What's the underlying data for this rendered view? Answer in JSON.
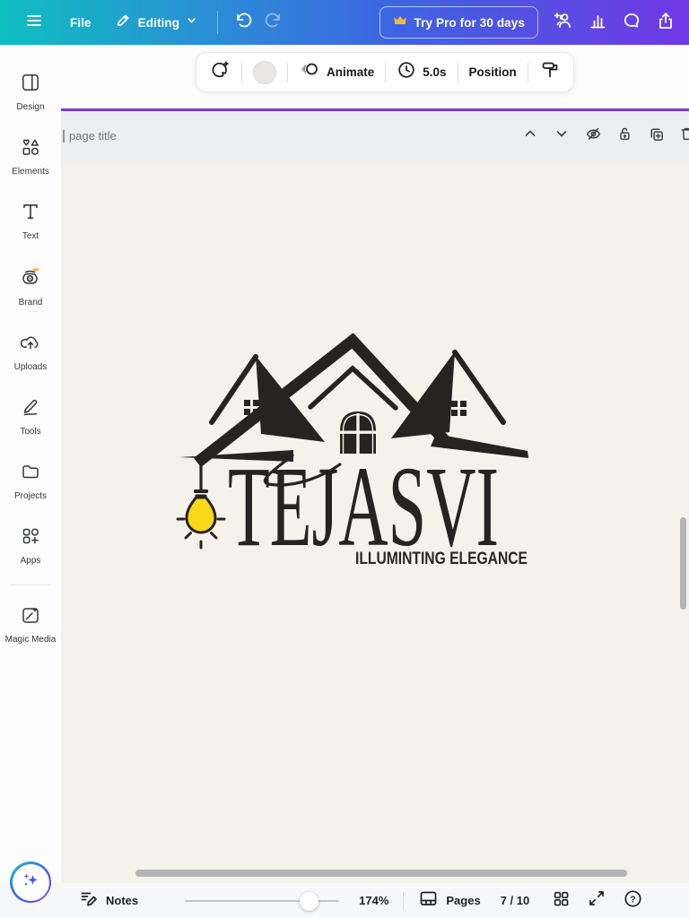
{
  "topbar": {
    "file_label": "File",
    "editing_label": "Editing",
    "try_pro_label": "Try Pro for 30 days"
  },
  "sidebar": {
    "items": [
      {
        "label": "Design"
      },
      {
        "label": "Elements"
      },
      {
        "label": "Text"
      },
      {
        "label": "Brand"
      },
      {
        "label": "Uploads"
      },
      {
        "label": "Tools"
      },
      {
        "label": "Projects"
      },
      {
        "label": "Apps"
      },
      {
        "label": "Magic Media"
      }
    ]
  },
  "context_toolbar": {
    "animate_label": "Animate",
    "duration": "5.0s",
    "position_label": "Position"
  },
  "page_header": {
    "title_placeholder": "page title"
  },
  "canvas": {
    "logo": {
      "brand_name": "TEJASVI",
      "tagline": "ILLUMINTING ELEGANCE",
      "ink_color": "#272320",
      "bulb_color": "#f7d917",
      "page_background": "#f5f2ec"
    }
  },
  "bottombar": {
    "notes_label": "Notes",
    "zoom_level": "174%",
    "pages_label": "Pages",
    "page_indicator": "7 / 10"
  },
  "colors": {
    "topbar_gradient_start": "#0fbfc0",
    "topbar_gradient_end": "#7138e6",
    "accent_purple": "#7d35e6",
    "crown_gold": "#f6b73c"
  }
}
